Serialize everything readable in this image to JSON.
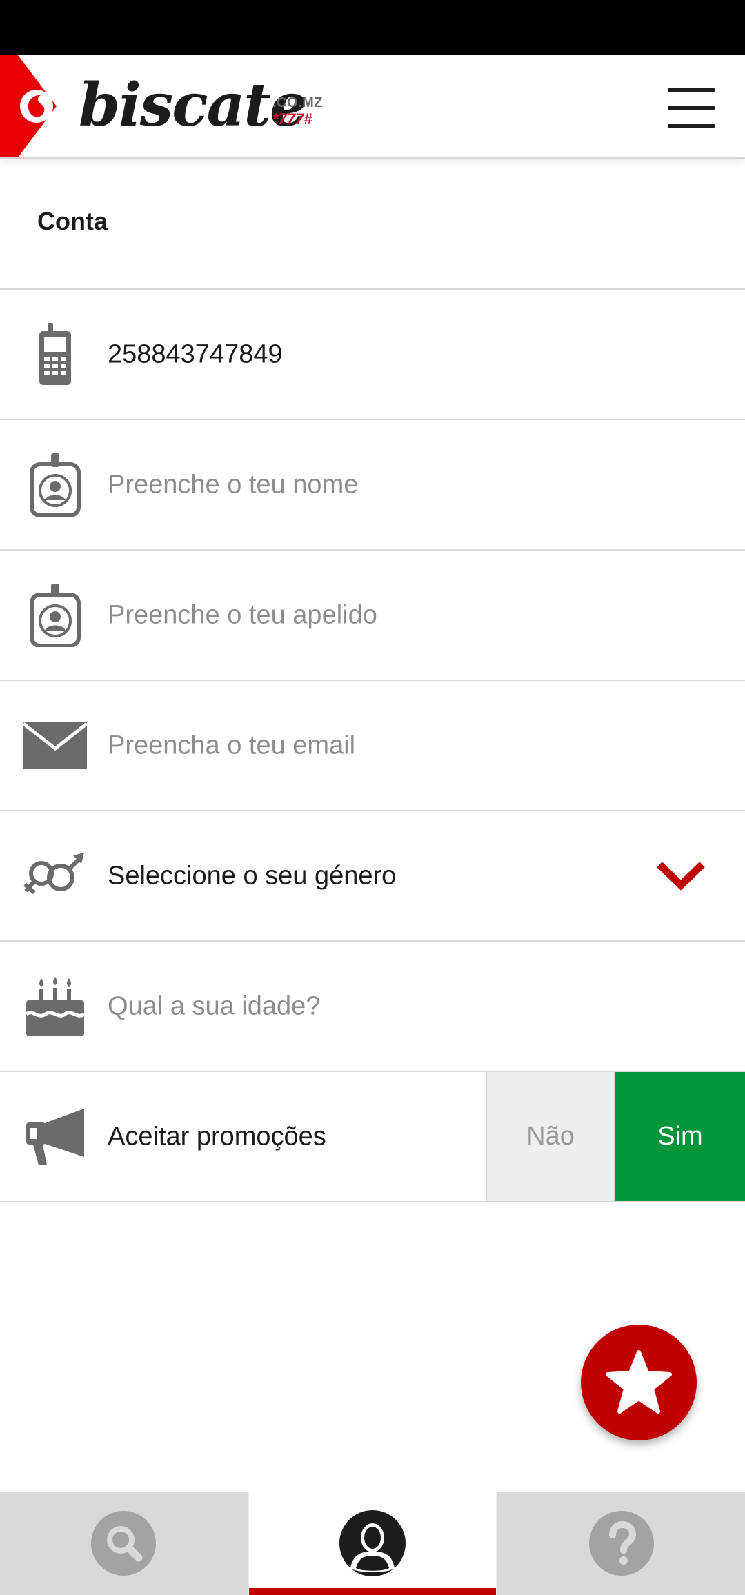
{
  "header": {
    "logo_text": "biscate",
    "logo_domain": ".CO.MZ",
    "logo_code": "*777#",
    "vodafone_icon": "vodafone-logo-icon",
    "menu_icon": "hamburger-menu-icon"
  },
  "account": {
    "title": "Conta",
    "phone": {
      "value": "258843747849",
      "icon": "mobile-phone-icon"
    },
    "first_name": {
      "placeholder": "Preenche o teu nome",
      "icon": "id-badge-icon"
    },
    "last_name": {
      "placeholder": "Preenche o teu apelido",
      "icon": "id-badge-icon"
    },
    "email": {
      "placeholder": "Preencha o teu email",
      "icon": "envelope-icon"
    },
    "gender": {
      "label": "Seleccione o seu género",
      "icon": "gender-symbols-icon",
      "dropdown_icon": "chevron-down-icon"
    },
    "age": {
      "placeholder": "Qual a sua idade?",
      "icon": "birthday-cake-icon"
    },
    "promotions": {
      "label": "Aceitar promoções",
      "icon": "megaphone-icon",
      "no_label": "Não",
      "yes_label": "Sim",
      "selected": "Sim"
    }
  },
  "fab": {
    "icon": "star-icon"
  },
  "bottom_nav": {
    "tabs": [
      {
        "icon": "search-icon",
        "active": false
      },
      {
        "icon": "user-profile-icon",
        "active": true
      },
      {
        "icon": "help-question-icon",
        "active": false
      }
    ]
  },
  "colors": {
    "brand_red": "#c00000",
    "accent_green": "#009639",
    "nav_gray": "#d8d9da",
    "icon_gray": "#6b6b6b",
    "placeholder_gray": "#8d8d8d"
  }
}
